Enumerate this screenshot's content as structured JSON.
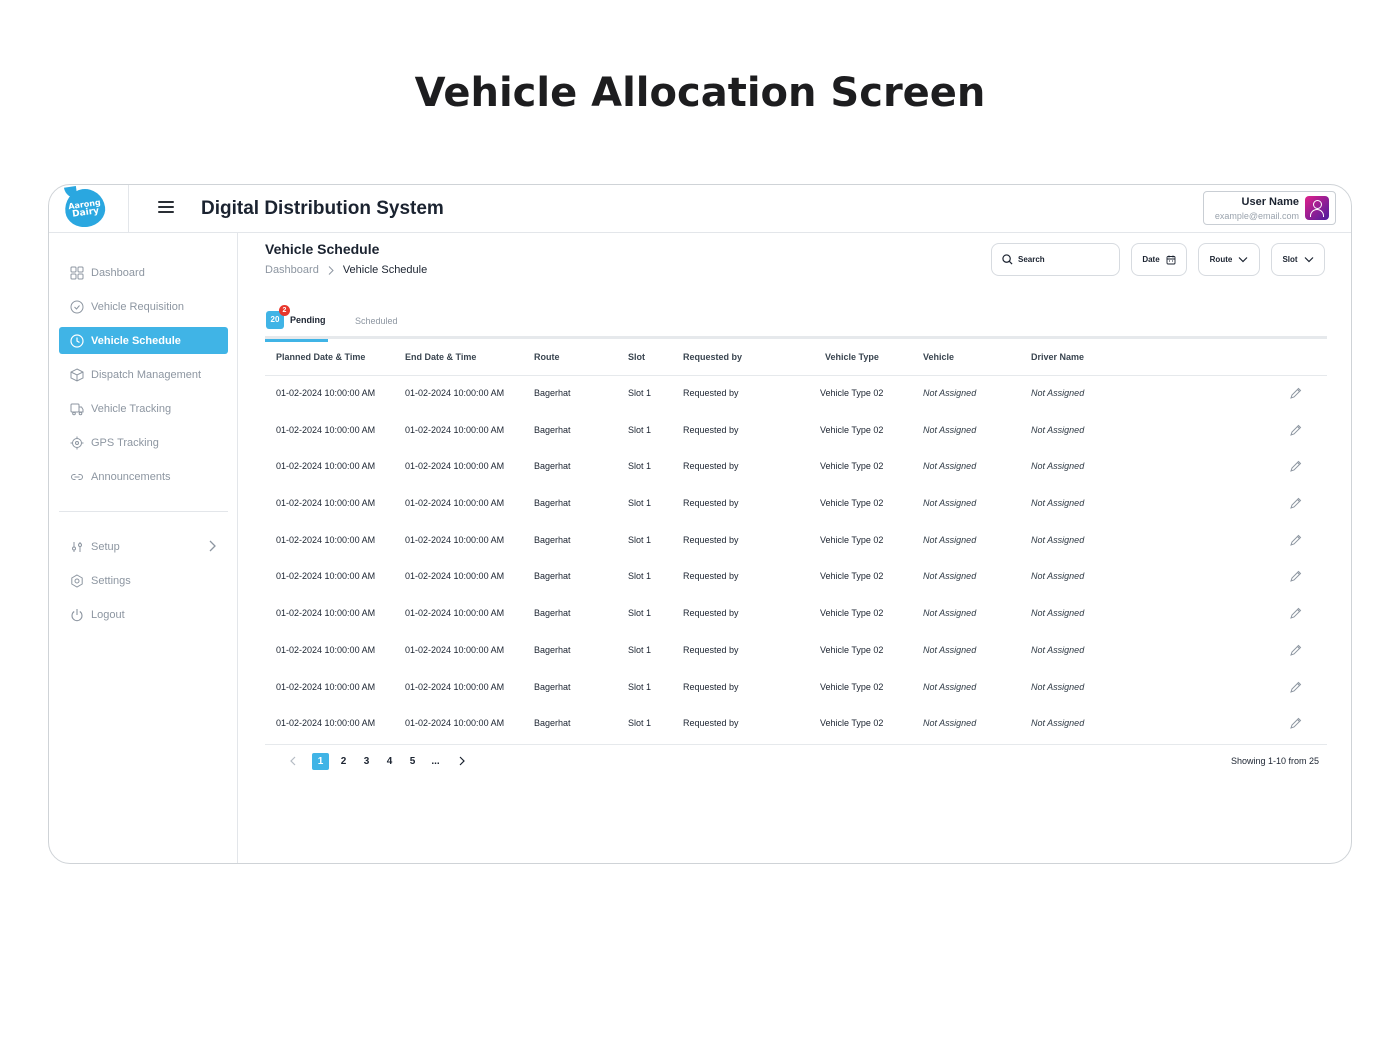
{
  "page_title": "Vehicle Allocation Screen",
  "header": {
    "logo_text_1": "Aarong",
    "logo_text_2": "Dairy",
    "app_name": "Digital Distribution System",
    "user_name": "User Name",
    "user_email": "example@email.com"
  },
  "sidebar": {
    "items": [
      {
        "label": "Dashboard",
        "icon": "grid-icon"
      },
      {
        "label": "Vehicle Requisition",
        "icon": "check-circle-icon"
      },
      {
        "label": "Vehicle Schedule",
        "icon": "clock-icon",
        "active": true
      },
      {
        "label": "Dispatch Management",
        "icon": "box-icon"
      },
      {
        "label": "Vehicle Tracking",
        "icon": "truck-icon"
      },
      {
        "label": "GPS Tracking",
        "icon": "target-icon"
      },
      {
        "label": "Announcements",
        "icon": "link-icon"
      }
    ],
    "bottom_items": [
      {
        "label": "Setup",
        "icon": "sliders-icon"
      },
      {
        "label": "Settings",
        "icon": "hexagon-gear-icon"
      },
      {
        "label": "Logout",
        "icon": "power-icon"
      }
    ]
  },
  "main": {
    "title": "Vehicle Schedule",
    "breadcrumb": {
      "root": "Dashboard",
      "current": "Vehicle Schedule"
    },
    "search_placeholder": "Search",
    "filters": {
      "date": "Date",
      "route": "Route",
      "slot": "Slot"
    },
    "tabs": {
      "pending_label": "Pending",
      "pending_count": "20",
      "pending_notification": "2",
      "scheduled_label": "Scheduled"
    },
    "table": {
      "headers": [
        "Planned Date & Time",
        "End Date & Time",
        "Route",
        "Slot",
        "Requested by",
        "Vehicle Type",
        "Vehicle",
        "Driver Name"
      ],
      "rows": [
        [
          "01-02-2024 10:00:00 AM",
          "01-02-2024 10:00:00 AM",
          "Bagerhat",
          "Slot 1",
          "Requested by",
          "Vehicle Type 02",
          "Not Assigned",
          "Not Assigned"
        ],
        [
          "01-02-2024 10:00:00 AM",
          "01-02-2024 10:00:00 AM",
          "Bagerhat",
          "Slot 1",
          "Requested by",
          "Vehicle Type 02",
          "Not Assigned",
          "Not Assigned"
        ],
        [
          "01-02-2024 10:00:00 AM",
          "01-02-2024 10:00:00 AM",
          "Bagerhat",
          "Slot 1",
          "Requested by",
          "Vehicle Type 02",
          "Not Assigned",
          "Not Assigned"
        ],
        [
          "01-02-2024 10:00:00 AM",
          "01-02-2024 10:00:00 AM",
          "Bagerhat",
          "Slot 1",
          "Requested by",
          "Vehicle Type 02",
          "Not Assigned",
          "Not Assigned"
        ],
        [
          "01-02-2024 10:00:00 AM",
          "01-02-2024 10:00:00 AM",
          "Bagerhat",
          "Slot 1",
          "Requested by",
          "Vehicle Type 02",
          "Not Assigned",
          "Not Assigned"
        ],
        [
          "01-02-2024 10:00:00 AM",
          "01-02-2024 10:00:00 AM",
          "Bagerhat",
          "Slot 1",
          "Requested by",
          "Vehicle Type 02",
          "Not Assigned",
          "Not Assigned"
        ],
        [
          "01-02-2024 10:00:00 AM",
          "01-02-2024 10:00:00 AM",
          "Bagerhat",
          "Slot 1",
          "Requested by",
          "Vehicle Type 02",
          "Not Assigned",
          "Not Assigned"
        ],
        [
          "01-02-2024 10:00:00 AM",
          "01-02-2024 10:00:00 AM",
          "Bagerhat",
          "Slot 1",
          "Requested by",
          "Vehicle Type 02",
          "Not Assigned",
          "Not Assigned"
        ],
        [
          "01-02-2024 10:00:00 AM",
          "01-02-2024 10:00:00 AM",
          "Bagerhat",
          "Slot 1",
          "Requested by",
          "Vehicle Type 02",
          "Not Assigned",
          "Not Assigned"
        ],
        [
          "01-02-2024 10:00:00 AM",
          "01-02-2024 10:00:00 AM",
          "Bagerhat",
          "Slot 1",
          "Requested by",
          "Vehicle Type 02",
          "Not Assigned",
          "Not Assigned"
        ]
      ]
    },
    "pagination": {
      "pages": [
        "1",
        "2",
        "3",
        "4",
        "5",
        "..."
      ],
      "current": "1",
      "showing": "Showing 1-10 from 25"
    }
  },
  "colors": {
    "accent": "#40b4e6",
    "badge_red": "#e8372c",
    "logo_blue": "#2aa7e0"
  }
}
